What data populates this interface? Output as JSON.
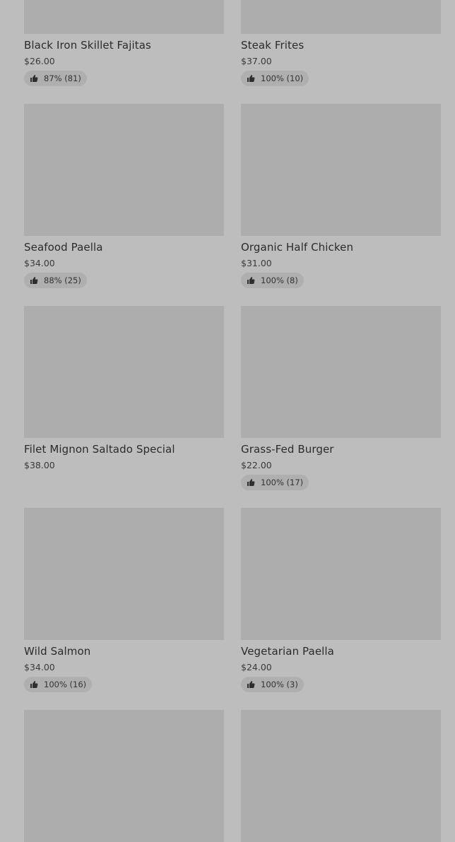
{
  "items": [
    {
      "name": "Black Iron Skillet Fajitas",
      "price": "$26.00",
      "rating": "87% (81)"
    },
    {
      "name": "Steak Frites",
      "price": "$37.00",
      "rating": "100% (10)"
    },
    {
      "name": "Seafood Paella",
      "price": "$34.00",
      "rating": "88% (25)"
    },
    {
      "name": "Organic Half Chicken",
      "price": "$31.00",
      "rating": "100% (8)"
    },
    {
      "name": "Filet Mignon Saltado Special",
      "price": "$38.00",
      "rating": ""
    },
    {
      "name": "Grass-Fed Burger",
      "price": "$22.00",
      "rating": "100% (17)"
    },
    {
      "name": "Wild Salmon",
      "price": "$34.00",
      "rating": "100% (16)"
    },
    {
      "name": "Vegetarian Paella",
      "price": "$24.00",
      "rating": "100% (3)"
    },
    {
      "name": "",
      "price": "",
      "rating": ""
    },
    {
      "name": "",
      "price": "",
      "rating": ""
    }
  ],
  "icons": {
    "rating_icon": "thumbs-up-icon"
  }
}
